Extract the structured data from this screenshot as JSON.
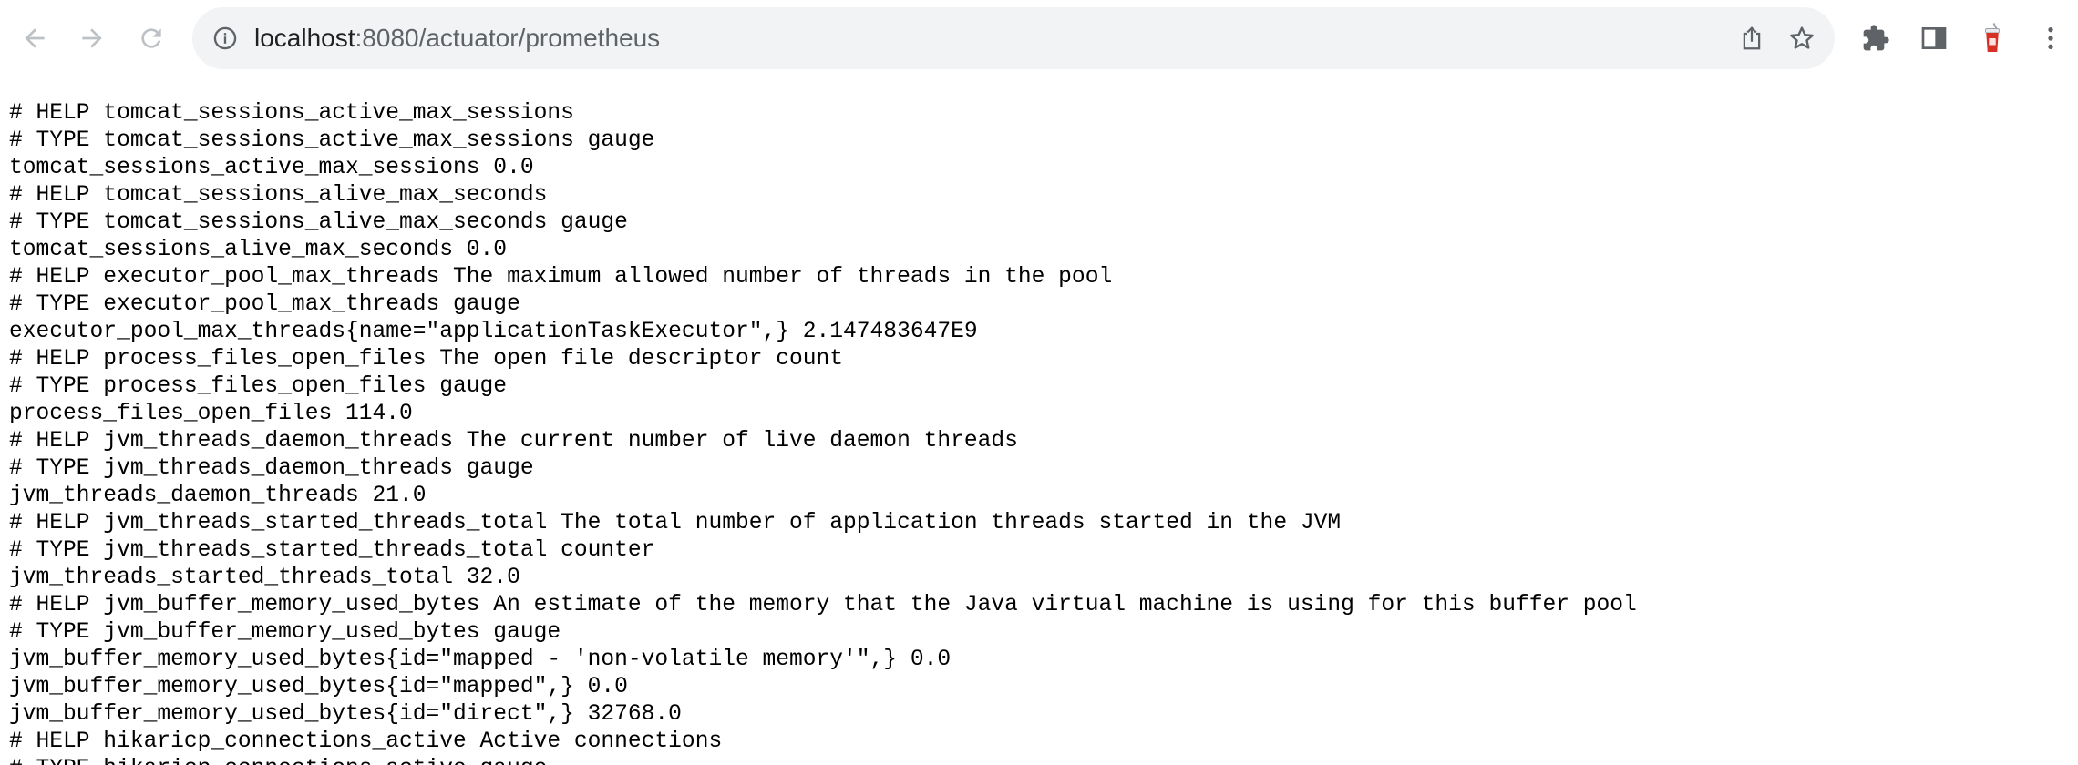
{
  "browser": {
    "url_host": "localhost",
    "url_path": ":8080/actuator/prometheus",
    "icons": {
      "back": "arrow-left-icon",
      "forward": "arrow-right-icon",
      "reload": "reload-icon",
      "site_info": "info-circle-icon",
      "share": "share-icon",
      "bookmark": "star-icon",
      "extensions": "puzzle-icon",
      "side_panel": "side-panel-icon",
      "profile": "extension-cup-icon",
      "menu": "kebab-menu-icon"
    },
    "colors": {
      "toolbar_bg": "#ffffff",
      "omnibox_bg": "#f1f3f4",
      "icon_gray": "#5f6368",
      "icon_disabled": "#bdc1c6",
      "extension_red": "#d93025"
    }
  },
  "page": {
    "lines": [
      "# HELP tomcat_sessions_active_max_sessions",
      "# TYPE tomcat_sessions_active_max_sessions gauge",
      "tomcat_sessions_active_max_sessions 0.0",
      "# HELP tomcat_sessions_alive_max_seconds",
      "# TYPE tomcat_sessions_alive_max_seconds gauge",
      "tomcat_sessions_alive_max_seconds 0.0",
      "# HELP executor_pool_max_threads The maximum allowed number of threads in the pool",
      "# TYPE executor_pool_max_threads gauge",
      "executor_pool_max_threads{name=\"applicationTaskExecutor\",} 2.147483647E9",
      "# HELP process_files_open_files The open file descriptor count",
      "# TYPE process_files_open_files gauge",
      "process_files_open_files 114.0",
      "# HELP jvm_threads_daemon_threads The current number of live daemon threads",
      "# TYPE jvm_threads_daemon_threads gauge",
      "jvm_threads_daemon_threads 21.0",
      "# HELP jvm_threads_started_threads_total The total number of application threads started in the JVM",
      "# TYPE jvm_threads_started_threads_total counter",
      "jvm_threads_started_threads_total 32.0",
      "# HELP jvm_buffer_memory_used_bytes An estimate of the memory that the Java virtual machine is using for this buffer pool",
      "# TYPE jvm_buffer_memory_used_bytes gauge",
      "jvm_buffer_memory_used_bytes{id=\"mapped - 'non-volatile memory'\",} 0.0",
      "jvm_buffer_memory_used_bytes{id=\"mapped\",} 0.0",
      "jvm_buffer_memory_used_bytes{id=\"direct\",} 32768.0",
      "# HELP hikaricp_connections_active Active connections",
      "# TYPE hikaricp_connections_active gauge"
    ]
  }
}
